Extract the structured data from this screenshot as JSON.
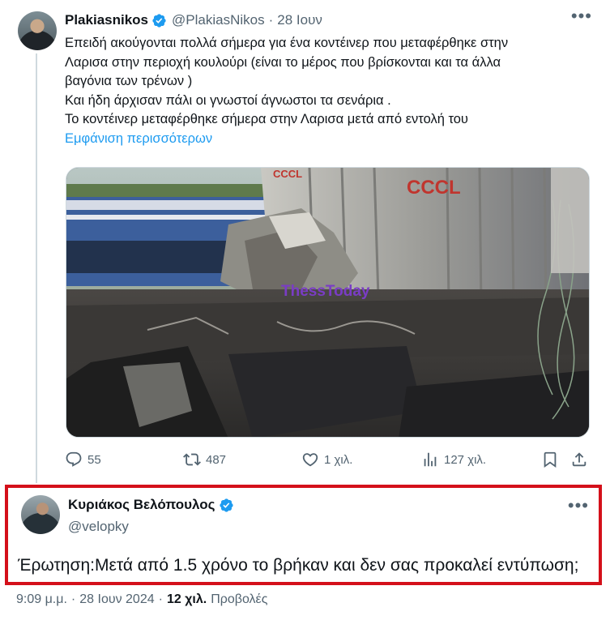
{
  "tweet": {
    "author_name": "Plakiasnikos",
    "author_handle": "@PlakiasNikos",
    "separator": "·",
    "date": "28 Ιουν",
    "more_icon": "more-icon",
    "lines": [
      "Επειδή ακούγονται πολλά σήμερα για ένα κοντέινερ που μεταφέρθηκε στην",
      "Λαρισα στην περιοχή κουλούρι (είναι το μέρος που βρίσκονται και τα άλλα",
      "βαγόνια των τρένων )",
      "Και ήδη άρχισαν πάλι οι γνωστοί άγνωστοι τα σενάρια .",
      "Το κοντέινερ μεταφέρθηκε σήμερα στην Λαρισα μετά από εντολή του"
    ],
    "show_more": "Εμφάνιση περισσότερων",
    "media_watermark": "ThessToday",
    "media_container_text_1": "CCCL",
    "media_container_text_2": "CCCL",
    "actions": {
      "replies": "55",
      "reposts": "487",
      "likes": "1 χιλ.",
      "views": "127 χιλ."
    }
  },
  "reply": {
    "author_name": "Κυριάκος Βελόπουλος",
    "author_handle": "@velopky",
    "text": "Έρωτηση:Μετά από 1.5 χρόνο το βρήκαν και δεν σας προκαλεί εντύπωση;",
    "highlight_color": "#d4101a"
  },
  "meta": {
    "time": "9:09 μ.μ.",
    "separator": "·",
    "date": "28 Ιουν 2024",
    "separator2": "·",
    "views_count": "12 χιλ.",
    "views_label": "Προβολές"
  },
  "colors": {
    "accent": "#1d9bf0",
    "secondary_text": "#536471",
    "primary_text": "#0f1419"
  }
}
